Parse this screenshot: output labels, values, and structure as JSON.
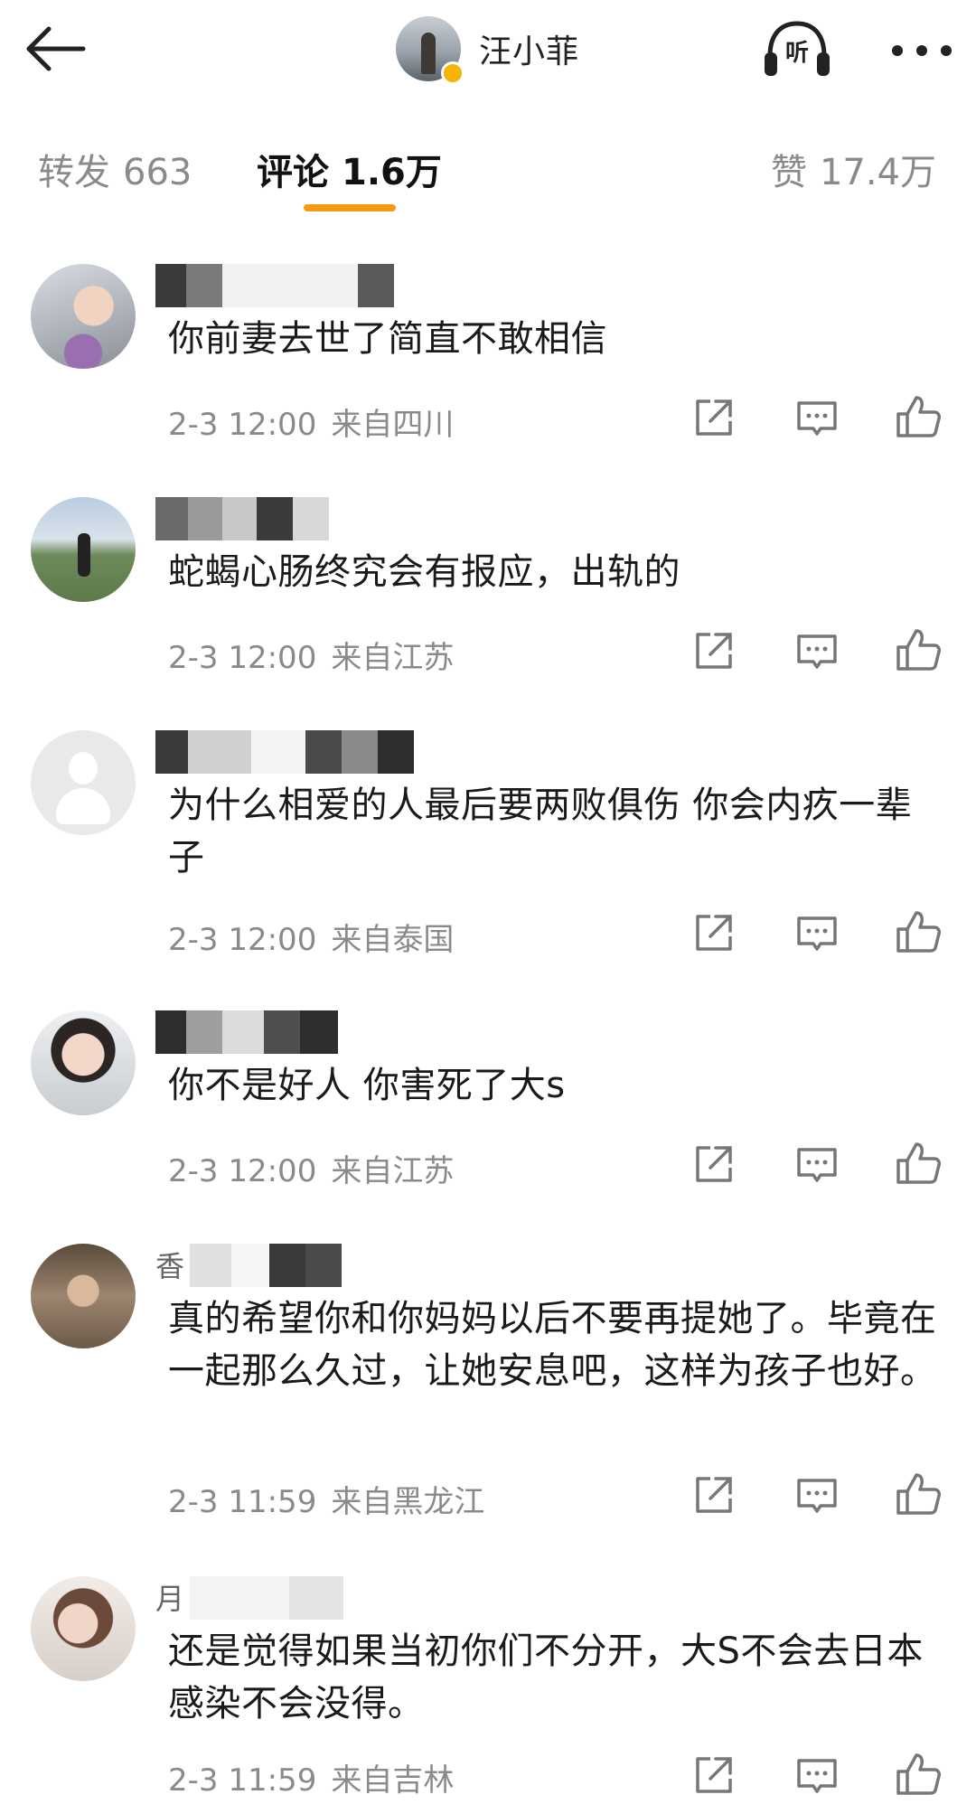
{
  "header": {
    "author_name": "汪小菲",
    "listen_label": "听",
    "icons": {
      "back": "arrow-left-icon",
      "listen": "headphones-icon",
      "more": "more-dots-icon",
      "verified": "verified-badge-icon"
    }
  },
  "tabs": [
    {
      "label": "转发",
      "count": "663",
      "active": false
    },
    {
      "label": "评论",
      "count": "1.6万",
      "active": true
    },
    {
      "label": "赞",
      "count": "17.4万",
      "active": false
    }
  ],
  "colors": {
    "accent": "#f59a13",
    "text_primary": "#1a1a1a",
    "text_secondary": "#8a8a8a",
    "verified": "#f5b400"
  },
  "comments": [
    {
      "text": "你前妻去世了简直不敢相信",
      "time": "2-3 12:00",
      "location": "来自四川",
      "name_visible": ""
    },
    {
      "text": "蛇蝎心肠终究会有报应，出轨的",
      "time": "2-3 12:00",
      "location": "来自江苏",
      "name_visible": ""
    },
    {
      "text": "为什么相爱的人最后要两败俱伤 你会内疚一辈子",
      "time": "2-3 12:00",
      "location": "来自泰国",
      "name_visible": ""
    },
    {
      "text": "你不是好人 你害死了大s",
      "time": "2-3 12:00",
      "location": "来自江苏",
      "name_visible": ""
    },
    {
      "text": "真的希望你和你妈妈以后不要再提她了。毕竟在一起那么久过，让她安息吧，这样为孩子也好。",
      "time": "2-3 11:59",
      "location": "来自黑龙江",
      "name_visible": "香"
    },
    {
      "text": "还是觉得如果当初你们不分开，大S不会去日本感染不会没得。",
      "time": "2-3 11:59",
      "location": "来自吉林",
      "name_visible": "月"
    }
  ],
  "action_icons": [
    "share-icon",
    "reply-icon",
    "like-icon"
  ]
}
